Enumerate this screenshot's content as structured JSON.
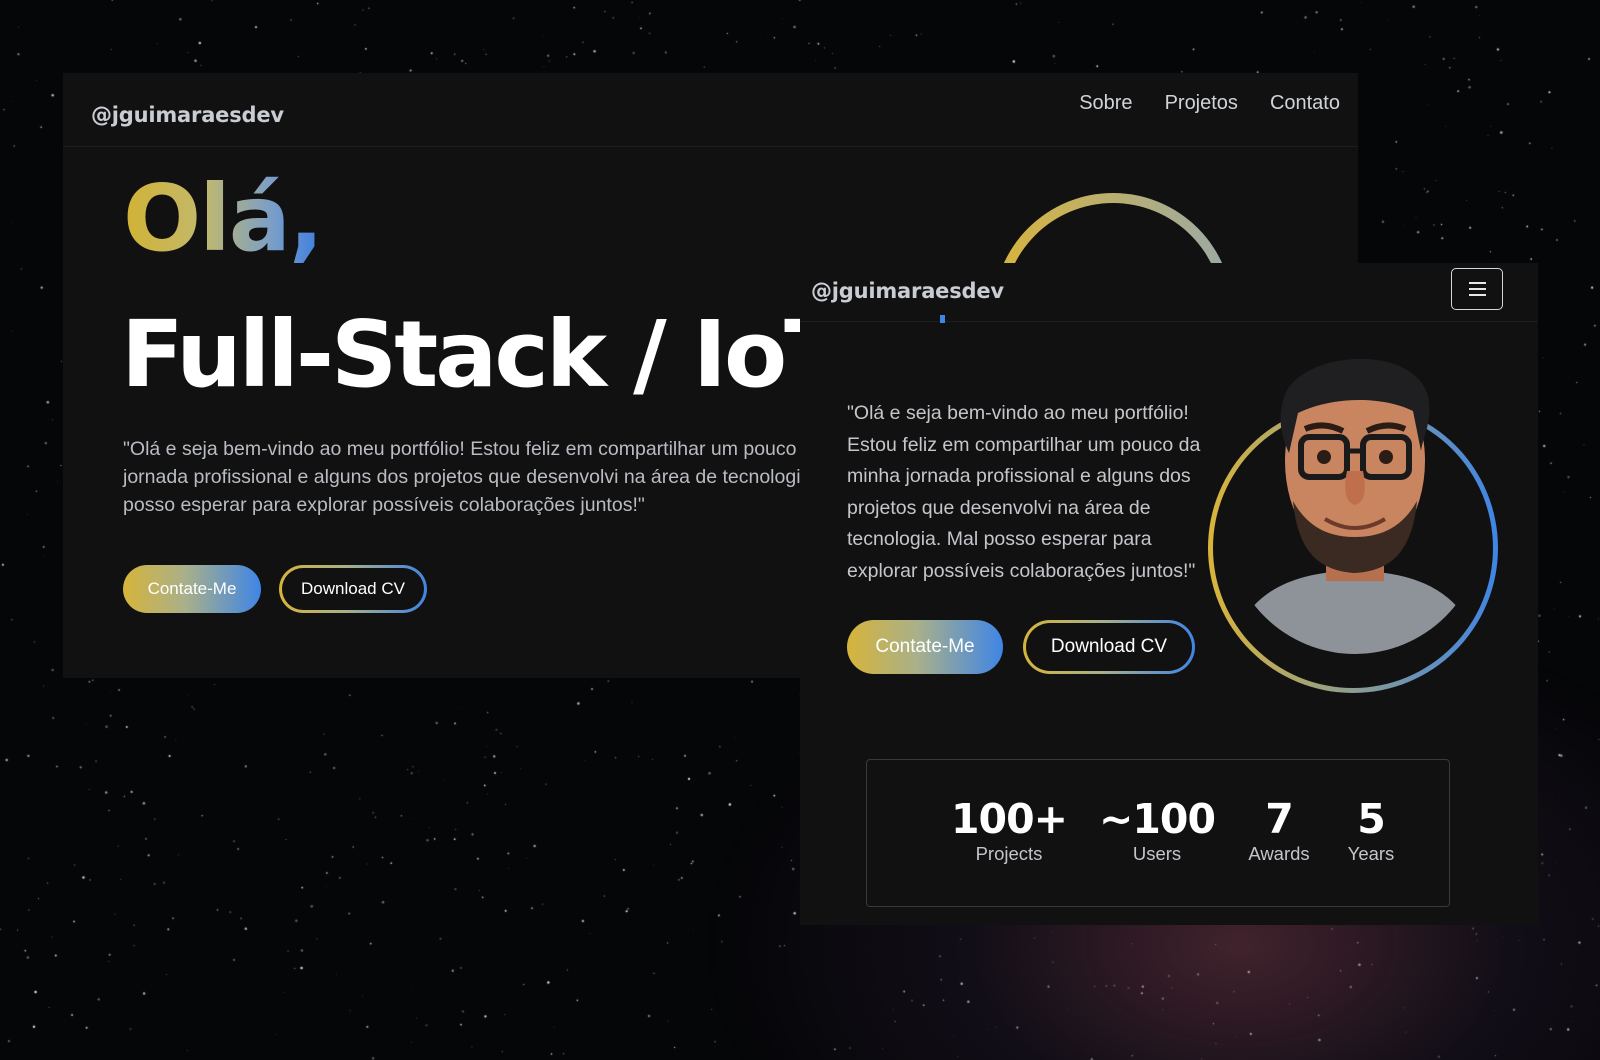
{
  "desktop": {
    "nav": {
      "brand": "@jguimaraesdev",
      "links": [
        "Sobre",
        "Projetos",
        "Contato"
      ]
    },
    "hero": {
      "greeting": "Olá,",
      "role": "Full-Stack / IoT",
      "intro": "\"Olá e seja bem-vindo ao meu portfólio! Estou feliz em compartilhar um pouco da minha jornada profissional e alguns dos projetos que desenvolvi na área de tecnologia. Mal posso esperar para explorar possíveis colaborações juntos!\"",
      "primary_button": "Contate-Me",
      "secondary_button": "Download CV"
    }
  },
  "mobile": {
    "nav": {
      "brand": "@jguimaraesdev",
      "menu_icon": "hamburger-menu-icon"
    },
    "hero": {
      "intro": "\"Olá e seja bem-vindo ao meu portfólio!\nEstou feliz em compartilhar um pouco da\nminha jornada profissional e alguns dos\nprojetos que desenvolvi na área de\ntecnologia. Mal posso esperar para\nexplorar possíveis colaborações juntos!\"",
      "primary_button": "Contate-Me",
      "secondary_button": "Download CV",
      "avatar": "developer-avatar"
    },
    "stats": [
      {
        "value": "100+",
        "label": "Projects"
      },
      {
        "value": "~100",
        "label": "Users"
      },
      {
        "value": "7",
        "label": "Awards"
      },
      {
        "value": "5",
        "label": "Years"
      }
    ]
  },
  "colors": {
    "gradient_start": "#d6b43a",
    "gradient_end": "#3f85e6",
    "panel": "#111111",
    "text": "#ffffff"
  }
}
